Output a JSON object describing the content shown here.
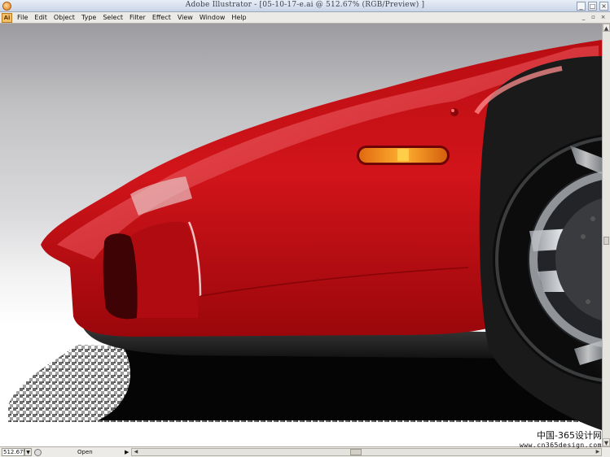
{
  "window": {
    "title": "Adobe Illustrator - [05-10-17-e.ai @ 512.67% (RGB/Preview) ]",
    "minimize_icon": "minimize-icon",
    "maximize_icon": "maximize-icon",
    "close_icon": "close-icon"
  },
  "menubar": {
    "items": [
      "File",
      "Edit",
      "Object",
      "Type",
      "Select",
      "Filter",
      "Effect",
      "View",
      "Window",
      "Help"
    ]
  },
  "artwork": {
    "subject": "red sports car front fender illustration",
    "colors": {
      "body": "#c80f14",
      "highlight": "#ff5a5a",
      "shadow": "#5a0306",
      "indicator": "#f08a1c",
      "tire": "#1b1b1b",
      "rim": "#c9cdd2"
    }
  },
  "statusbar": {
    "zoom": "512.67%",
    "status": "Open"
  },
  "watermark": {
    "line1": "中国-365设计网",
    "line2": "www.cn365design.com"
  }
}
